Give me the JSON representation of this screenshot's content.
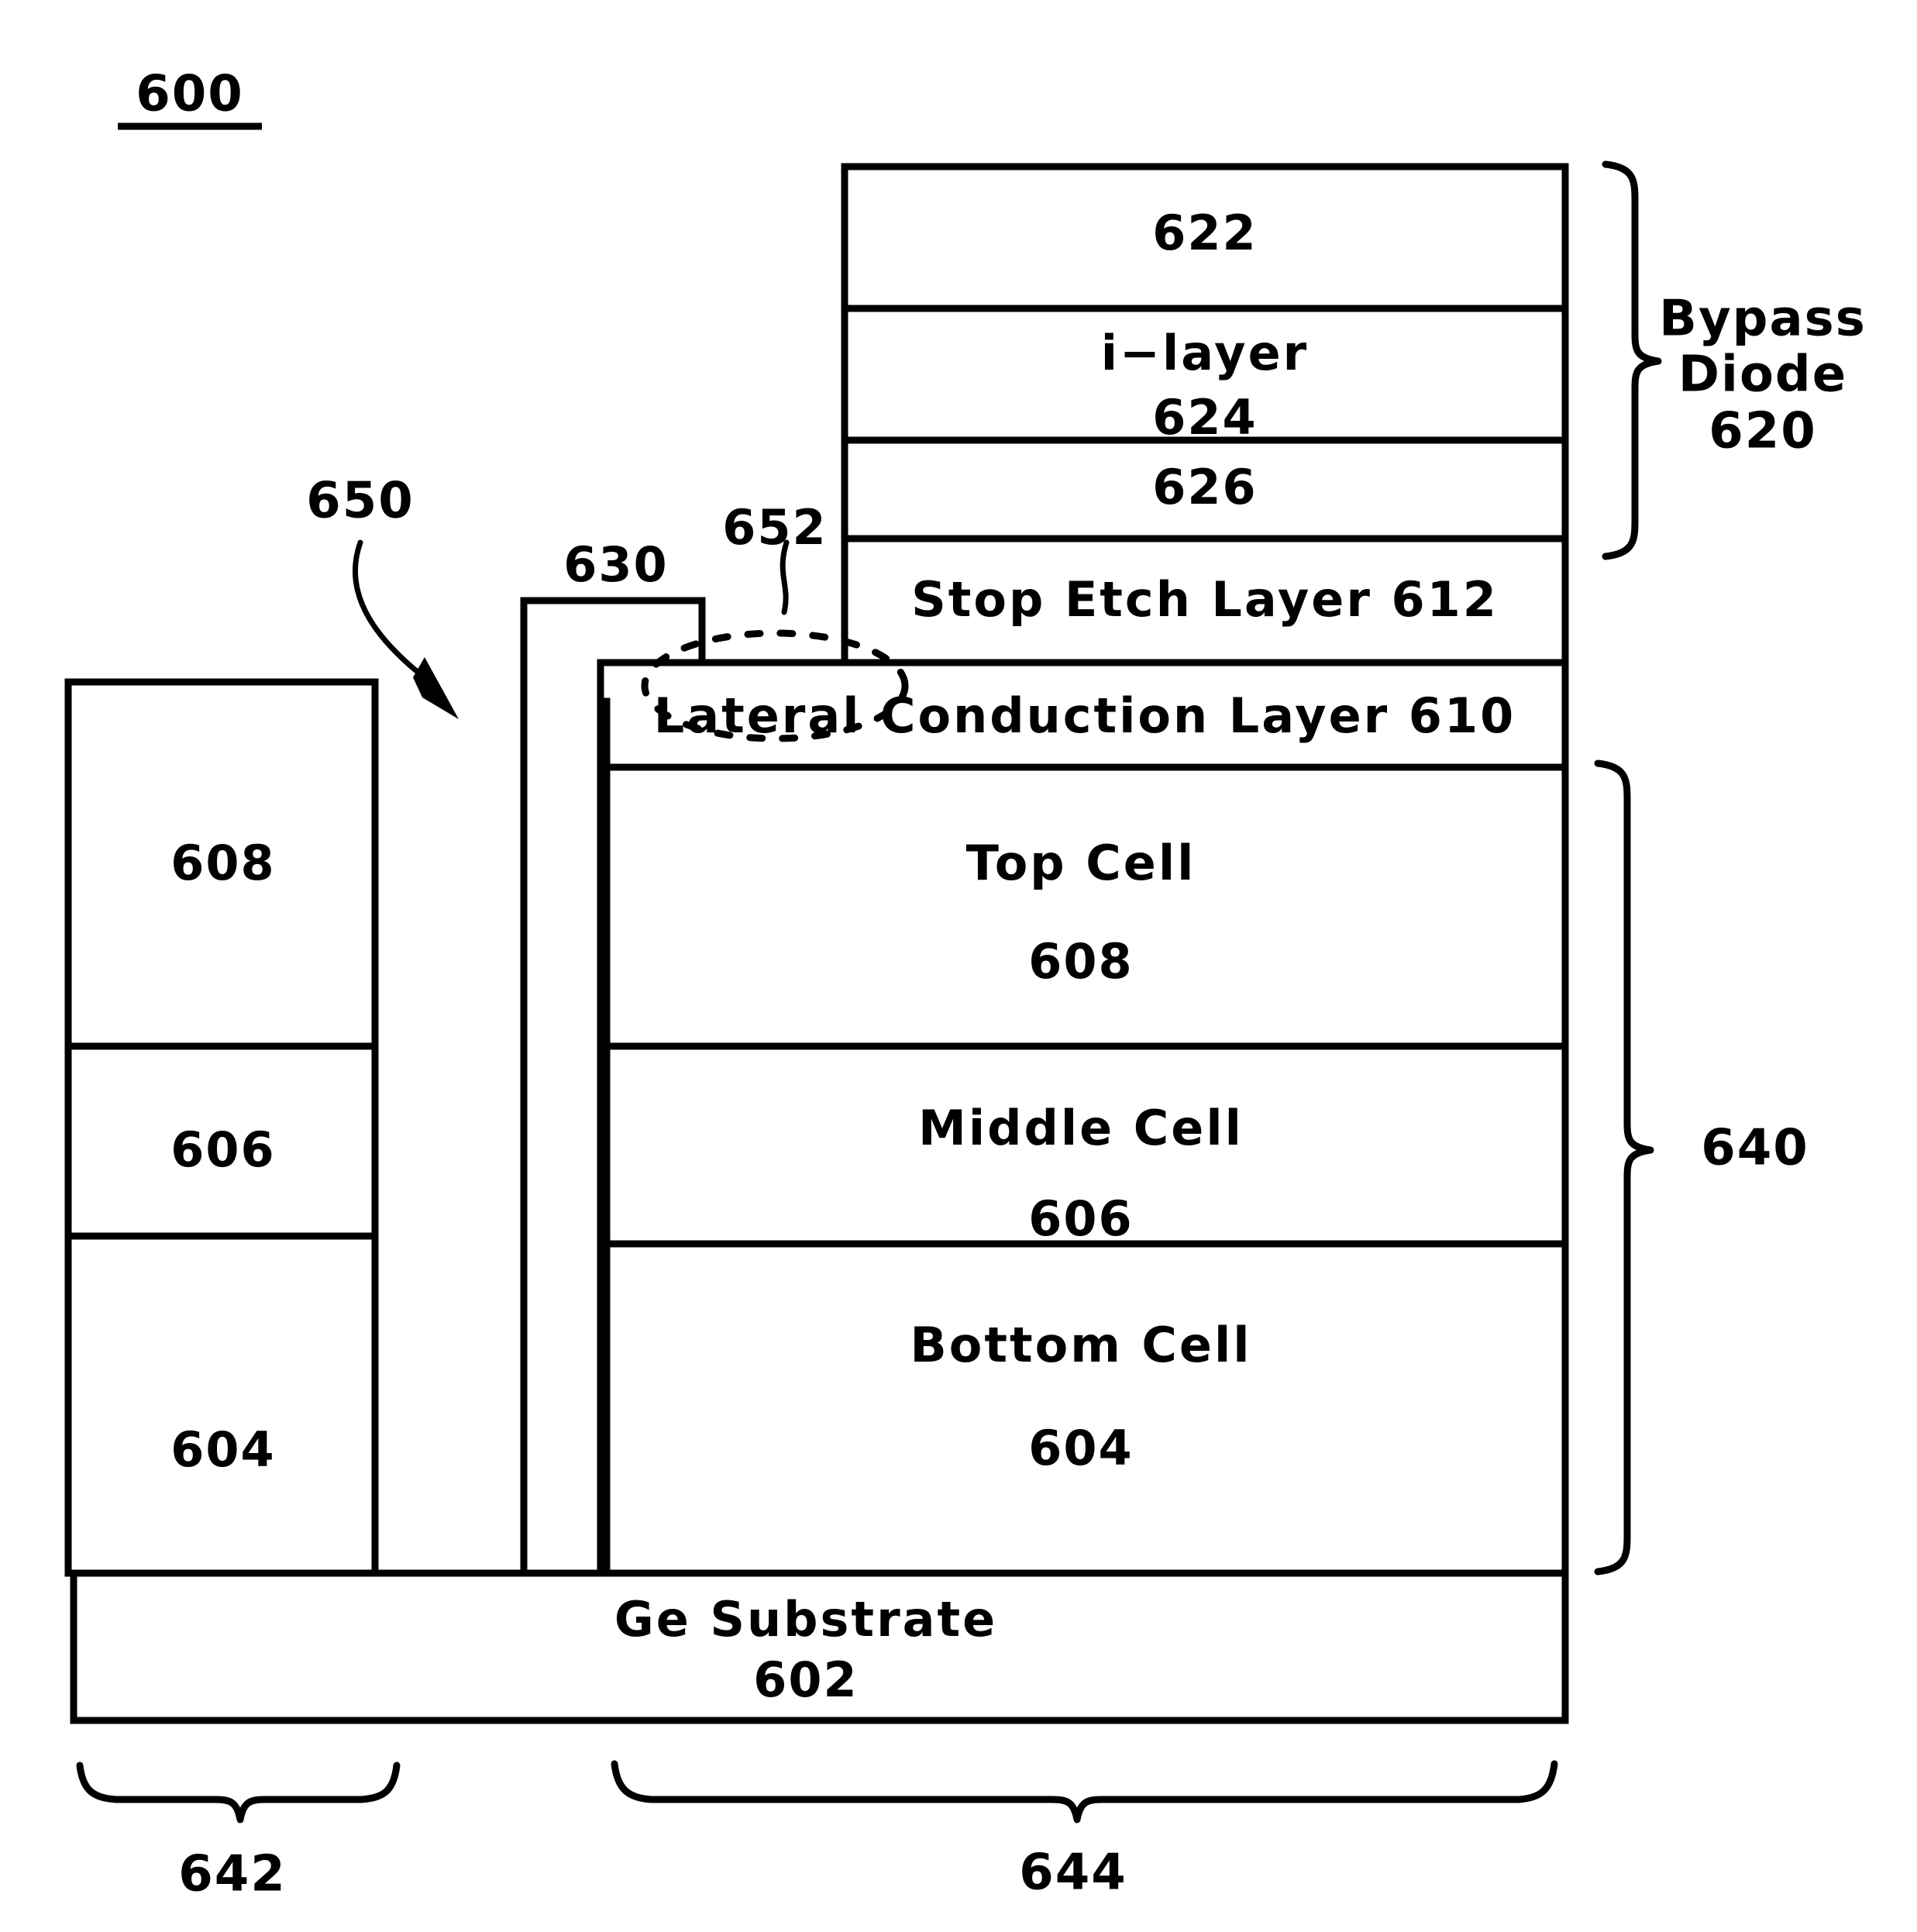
{
  "figure": {
    "id_label": "600",
    "title_underlined": true
  },
  "bypass_diode": {
    "bracket_label_line1": "Bypass",
    "bracket_label_line2": "Diode",
    "bracket_label_line3": "620",
    "layers": [
      {
        "name": "top-contact-layer",
        "label": "622",
        "sublabel": ""
      },
      {
        "name": "i-layer",
        "label": "i−layer",
        "sublabel": "624"
      },
      {
        "name": "bottom-contact-layer",
        "label": "626",
        "sublabel": ""
      }
    ]
  },
  "stop_etch_layer": {
    "label": "Stop  Etch  Layer  612"
  },
  "lateral_conduction_layer": {
    "label": "Lateral  Conduction  Layer  610"
  },
  "solar_cell_stack": {
    "bracket_label": "640",
    "cells": [
      {
        "name": "top-cell",
        "label": "Top  Cell",
        "sublabel": "608"
      },
      {
        "name": "middle-cell",
        "label": "Middle  Cell",
        "sublabel": "606"
      },
      {
        "name": "bottom-cell",
        "label": "Bottom  Cell",
        "sublabel": "604"
      }
    ]
  },
  "substrate": {
    "label": "Ge  Substrate",
    "sublabel": "602"
  },
  "left_mesa": {
    "layers": [
      {
        "name": "left-mesa-608",
        "label": "608"
      },
      {
        "name": "left-mesa-606",
        "label": "606"
      },
      {
        "name": "left-mesa-604",
        "label": "604"
      }
    ]
  },
  "callouts": {
    "arrow_650": "650",
    "column_630": "630",
    "ellipse_652": "652"
  },
  "bottom_brackets": {
    "left": "642",
    "right": "644"
  },
  "colors": {
    "line": "#000000",
    "background": "#ffffff"
  }
}
